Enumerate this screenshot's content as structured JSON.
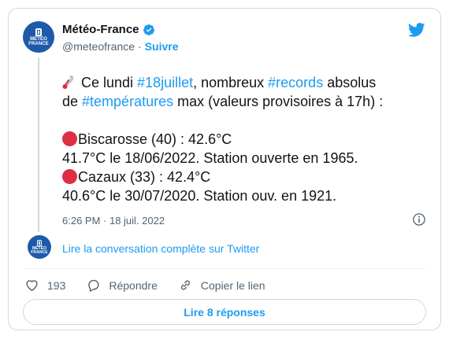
{
  "author": {
    "name": "Météo-France",
    "handle": "@meteofrance",
    "separator": "·",
    "follow_label": "Suivre",
    "avatar_text": [
      "MÉTÉO",
      "FRANCE"
    ]
  },
  "tweet": {
    "line1": {
      "prefix": "Ce lundi ",
      "tag1": "#18juillet",
      "middle": ", nombreux ",
      "tag2": "#records",
      "suffix": " absolus"
    },
    "line2": {
      "prefix": "de ",
      "tag": "#températures",
      "suffix": " max (valeurs provisoires à 17h) :"
    },
    "record1": {
      "station": "Biscarosse (40) : 42.6°C",
      "previous": "41.7°C le 18/06/2022. Station ouverte en 1965."
    },
    "record2": {
      "station": "Cazaux (33) : 42.4°C",
      "previous": "40.6°C le 30/07/2020. Station ouv. en 1921."
    },
    "timestamp": "6:26 PM · 18 juil. 2022"
  },
  "conversation_link": "Lire la conversation complète sur Twitter",
  "actions": {
    "likes": "193",
    "reply_label": "Répondre",
    "copy_label": "Copier le lien"
  },
  "replies_button": "Lire 8 réponses",
  "icons": [
    "thermometer-icon",
    "red-circle-icon",
    "verified-badge-icon",
    "twitter-logo-icon",
    "info-icon",
    "heart-icon",
    "reply-icon",
    "link-icon"
  ],
  "colors": {
    "accent": "#1d9bf0",
    "avatar": "#1e5aa8",
    "red_circle": "#dd2e44",
    "muted": "#536471"
  }
}
